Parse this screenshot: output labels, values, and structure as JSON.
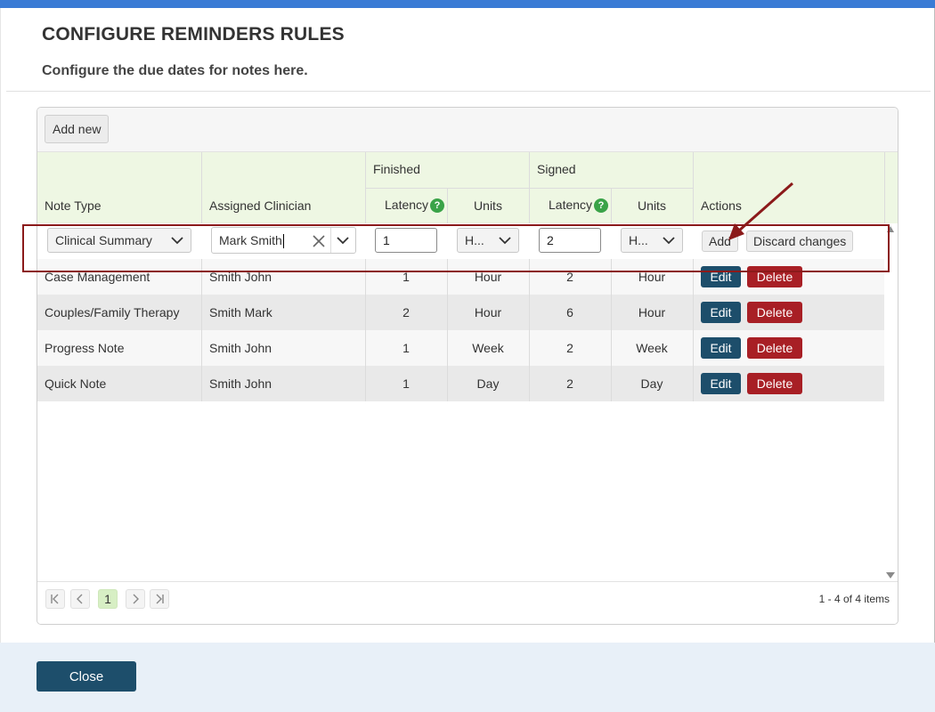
{
  "dialog": {
    "title": "CONFIGURE REMINDERS RULES",
    "subtitle": "Configure the due dates for notes here."
  },
  "toolbar": {
    "add_new_label": "Add new"
  },
  "columns": {
    "note_type": "Note Type",
    "assigned_clinician": "Assigned Clinician",
    "finished_group": "Finished",
    "signed_group": "Signed",
    "latency": "Latency",
    "units": "Units",
    "actions": "Actions",
    "help_glyph": "?"
  },
  "edit_row": {
    "note_type_value": "Clinical Summary",
    "clinician_value": "Mark Smith",
    "finished_latency": "1",
    "finished_units": "H...",
    "signed_latency": "2",
    "signed_units": "H...",
    "add_label": "Add",
    "discard_label": "Discard changes"
  },
  "rows": [
    {
      "note_type": "Case Management",
      "clinician": "Smith John",
      "finished_latency": "1",
      "finished_units": "Hour",
      "signed_latency": "2",
      "signed_units": "Hour"
    },
    {
      "note_type": "Couples/Family Therapy",
      "clinician": "Smith Mark",
      "finished_latency": "2",
      "finished_units": "Hour",
      "signed_latency": "6",
      "signed_units": "Hour"
    },
    {
      "note_type": "Progress Note",
      "clinician": "Smith John",
      "finished_latency": "1",
      "finished_units": "Week",
      "signed_latency": "2",
      "signed_units": "Week"
    },
    {
      "note_type": "Quick Note",
      "clinician": "Smith John",
      "finished_latency": "1",
      "finished_units": "Day",
      "signed_latency": "2",
      "signed_units": "Day"
    }
  ],
  "row_actions": {
    "edit_label": "Edit",
    "delete_label": "Delete"
  },
  "pager": {
    "current_page": "1",
    "info": "1 - 4 of 4 items"
  },
  "footer": {
    "close_label": "Close"
  },
  "colors": {
    "header_bg": "#eef7e3",
    "primary_button": "#1d4e6b",
    "danger_button": "#a81f25",
    "annotation": "#8b1a1a",
    "help_icon": "#3aa348"
  }
}
